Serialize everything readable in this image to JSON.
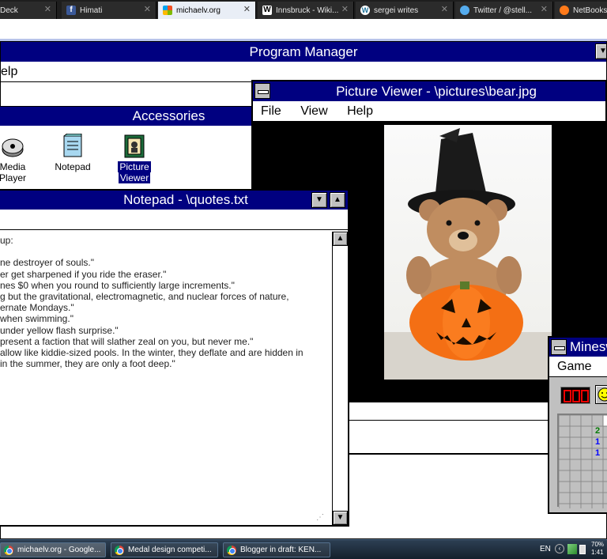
{
  "browser": {
    "tabs": [
      {
        "label": "Deck",
        "icon": "tweetdeck-icon"
      },
      {
        "label": "Himati",
        "icon": "facebook-icon"
      },
      {
        "label": "michaelv.org",
        "icon": "windows-logo-icon",
        "active": true
      },
      {
        "label": "Innsbruck - Wiki...",
        "icon": "wikipedia-icon"
      },
      {
        "label": "sergei writes",
        "icon": "wordpress-icon"
      },
      {
        "label": "Twitter / @stell...",
        "icon": "twitter-icon"
      },
      {
        "label": "NetBooks P",
        "icon": "netbooks-icon"
      }
    ]
  },
  "program_manager": {
    "title": "Program Manager",
    "menu_fragment": "elp"
  },
  "accessories": {
    "title": "Accessories",
    "items": [
      {
        "label_line1": "Media",
        "label_line2": "Player",
        "icon": "media-player-icon"
      },
      {
        "label_line1": "Notepad",
        "label_line2": "",
        "icon": "notepad-icon"
      },
      {
        "label_line1": "Picture",
        "label_line2": "Viewer",
        "icon": "picture-viewer-icon",
        "selected": true
      }
    ]
  },
  "notepad": {
    "title": "Notepad - \\quotes.txt",
    "lines": [
      "up:",
      "",
      "ne destroyer of souls.\"",
      "er get sharpened if you ride the eraser.\"",
      "nes $0 when you round to sufficiently large increments.\"",
      "g but the gravitational, electromagnetic, and nuclear forces of nature,",
      "ernate Mondays.\"",
      "when swimming.\"",
      "under yellow flash surprise.\"",
      "present a faction that will slather zeal on you, but never me.\"",
      "allow like kiddie-sized pools. In the winter, they deflate and are hidden in",
      " in the summer, they are only a foot deep.\""
    ]
  },
  "picture_viewer": {
    "title": "Picture Viewer - \\pictures\\bear.jpg",
    "menu": [
      "File",
      "View",
      "Help"
    ]
  },
  "minesweeper": {
    "title": "Minesw",
    "menu": [
      "Game"
    ],
    "visible_numbers": [
      "2",
      "1",
      "1"
    ]
  },
  "taskbar": {
    "tasks": [
      {
        "label": "michaelv.org - Google...",
        "active": true
      },
      {
        "label": "Medal design competi..."
      },
      {
        "label": "Blogger in draft: KEN..."
      }
    ],
    "language": "EN",
    "tray_text": "70%",
    "clock": "1:41"
  }
}
